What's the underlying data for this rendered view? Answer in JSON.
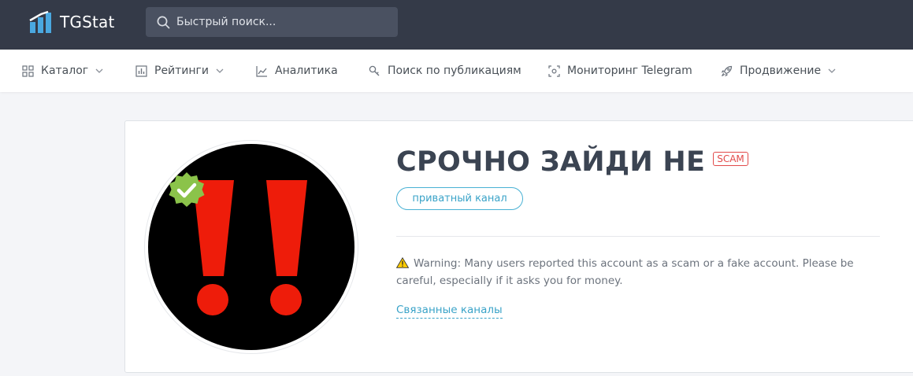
{
  "header": {
    "logo_text": "TGStat",
    "search_placeholder": "Быстрый поиск..."
  },
  "nav": {
    "items": [
      {
        "label": "Каталог",
        "icon": "grid-icon",
        "dropdown": true
      },
      {
        "label": "Рейтинги",
        "icon": "bar-chart-icon",
        "dropdown": true
      },
      {
        "label": "Аналитика",
        "icon": "line-chart-icon",
        "dropdown": false
      },
      {
        "label": "Поиск по публикациям",
        "icon": "search-key-icon",
        "dropdown": false
      },
      {
        "label": "Мониторинг Telegram",
        "icon": "scan-icon",
        "dropdown": false
      },
      {
        "label": "Продвижение",
        "icon": "rocket-icon",
        "dropdown": true
      }
    ]
  },
  "channel": {
    "title": "СРОЧНО ЗАЙДИ НЕ",
    "badge": "SCAM",
    "type_label": "приватный канал",
    "warning_text": "Warning: Many users reported this account as a scam or a fake account. Please be careful, especially if it asks you for money.",
    "related_link": "Связанные каналы",
    "verified": true
  },
  "colors": {
    "topbar": "#343a48",
    "accent": "#3aa3c8",
    "scam": "#e24a4a",
    "verified": "#8bc34a",
    "avatar_marks": "#ee1c0a"
  }
}
